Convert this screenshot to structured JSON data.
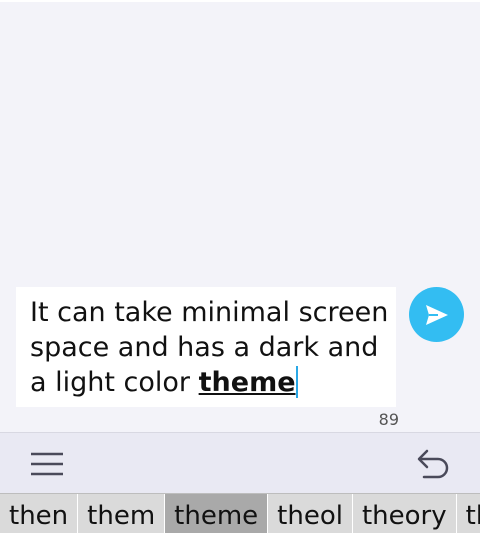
{
  "compose": {
    "text_before": "It can take minimal screen space and has a dark and a light color ",
    "text_emphasis": "theme",
    "char_count": "89"
  },
  "suggestions": [
    {
      "label": "then"
    },
    {
      "label": "them"
    },
    {
      "label": "theme",
      "active": true
    },
    {
      "label": "theol"
    },
    {
      "label": "theory"
    },
    {
      "label": "them"
    }
  ],
  "colors": {
    "accent": "#33bdf2",
    "background": "#f3f3f9",
    "toolbar": "#e9e9f3",
    "suggestion_bar": "#dadada"
  },
  "icons": {
    "send": "send-icon",
    "menu": "menu-icon",
    "undo": "undo-icon"
  }
}
